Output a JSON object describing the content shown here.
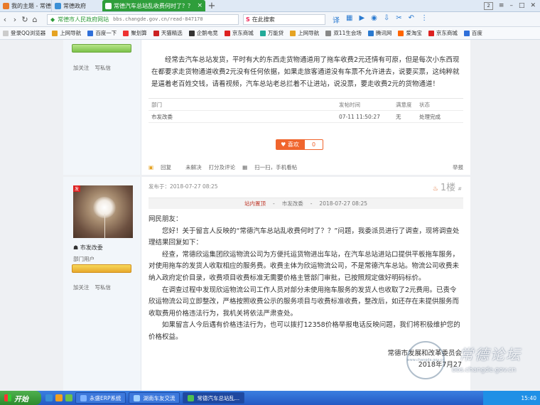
{
  "browser": {
    "tabs": [
      {
        "label": "我的主题 - 常德论坛",
        "color": "#e87a2a"
      },
      {
        "label": "常德政府",
        "color": "#3a8fd6"
      },
      {
        "label": "常德汽车总站乱收费何时了？？",
        "color": "#ffffff"
      }
    ],
    "tab_counter": "2",
    "address": {
      "site_name": "常德市人民政府网站",
      "url": "bbs.changde.gov.cn/read-847170"
    },
    "search": {
      "placeholder": "在此搜索"
    },
    "bookmarks": [
      {
        "label": "登录QQ浏览器",
        "color": "#ccc"
      },
      {
        "label": "上网导航",
        "color": "#e5a323"
      },
      {
        "label": "百度一下",
        "color": "#2f6fd9"
      },
      {
        "label": "聚划算",
        "color": "#e33"
      },
      {
        "label": "天猫精选",
        "color": "#c22"
      },
      {
        "label": "企鹅电竞",
        "color": "#333"
      },
      {
        "label": "京东商城",
        "color": "#d22"
      },
      {
        "label": "万能贷",
        "color": "#2a9"
      },
      {
        "label": "上网导航",
        "color": "#e5a323"
      },
      {
        "label": "双11生会场",
        "color": "#888"
      },
      {
        "label": "腾讯网",
        "color": "#2a7ad0"
      },
      {
        "label": "爱淘宝",
        "color": "#f60"
      },
      {
        "label": "京东商城",
        "color": "#d22"
      },
      {
        "label": "百度",
        "color": "#2f6fd9"
      }
    ]
  },
  "post1": {
    "side_links": [
      "加关注",
      "写私信"
    ],
    "text": "经常去汽车总站发货，平时有大的东西走货物通道用了拖车收费2元还情有可原，但是每次小东西现在都要求走货物通道收费2元没有任何依据，如果走旅客通道没有车票不允许进去，说要买票，这纯粹就是逼着老百姓交钱，请看视频，汽车总站老总拦着不让进站，说没票，要走收费2元的货物通道！",
    "table": {
      "headers": [
        "部门",
        "发帖时间",
        "满意度",
        "状态"
      ],
      "row": [
        "市发改委",
        "07-11 11:50:27",
        "无",
        "处理完成"
      ]
    },
    "like_label": "喜欢",
    "like_count": "0",
    "actions": [
      "回复",
      "未解决",
      "打分及评论",
      "扫一扫，手机看帖"
    ],
    "report": "举报"
  },
  "post2": {
    "avatar_tag": "发",
    "username": "市发改委",
    "group": "部门用户",
    "side_links": [
      "加关注",
      "写私信"
    ],
    "posted": "发布于：2018-07-27 08:25",
    "floor": "1楼",
    "stamp": {
      "label": "站内置顶",
      "dept": "市发改委",
      "time": "2018-07-27 08:25"
    },
    "paragraphs": [
      "网民朋友：",
      "您好！关于留言人反映的“常德汽车总站乱收费何时了？？”问题，我委派员进行了调查，现将调查处理结果回复如下：",
      "经查，常德欣运集团欣运物流公司为方便托运货物进出车站，在汽车总站进站口提供平板拖车服务，对使用拖车的发货人收取相应的服务费。收费主体为欣运物流公司，不是常德汽车总站。物流公司收费未纳入政府定价目录，收费项目收费标准无需要价格主管部门审批，已按照规定做好明码标价。",
      "在调查过程中发现欣运物流公司工作人员对部分未使用拖车服务的发货人也收取了2元费用。已责令欣运物流公司立即整改，严格按照收费公示的服务项目与收费标准收费，整改后，如还存在未提供服务而收取费用价格违法行为，我机关将依法严肃查处。",
      "如果留言人今后遇有价格违法行为，也可以拨打12358价格举报电话反映问题，我们将积极维护您的价格权益。"
    ],
    "signature": "常德市发展和改革委员会",
    "date": "2018年7月27"
  },
  "watermark": {
    "title": "常德论坛",
    "url": "bbs.changde.gov.cn",
    "seal": "www.changde.gov.cn"
  },
  "taskbar": {
    "start": "开始",
    "tasks": [
      "永盛ERP系统",
      "湖南车友交流",
      "常德汽车总站乱..."
    ],
    "clock": "15:40"
  }
}
